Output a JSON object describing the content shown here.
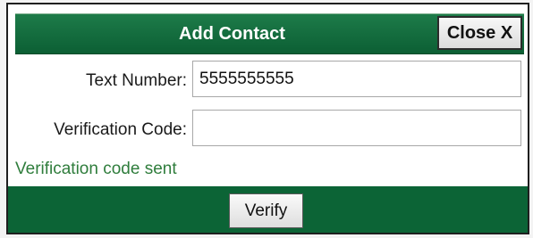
{
  "dialog": {
    "title": "Add Contact",
    "close_label": "Close X"
  },
  "form": {
    "text_number_label": "Text Number:",
    "text_number_value": "5555555555",
    "verification_code_label": "Verification Code:",
    "verification_code_value": ""
  },
  "status_text": "Verification code sent",
  "footer": {
    "verify_label": "Verify"
  },
  "colors": {
    "header_green": "#0c6436",
    "status_green": "#2f7d3c"
  }
}
